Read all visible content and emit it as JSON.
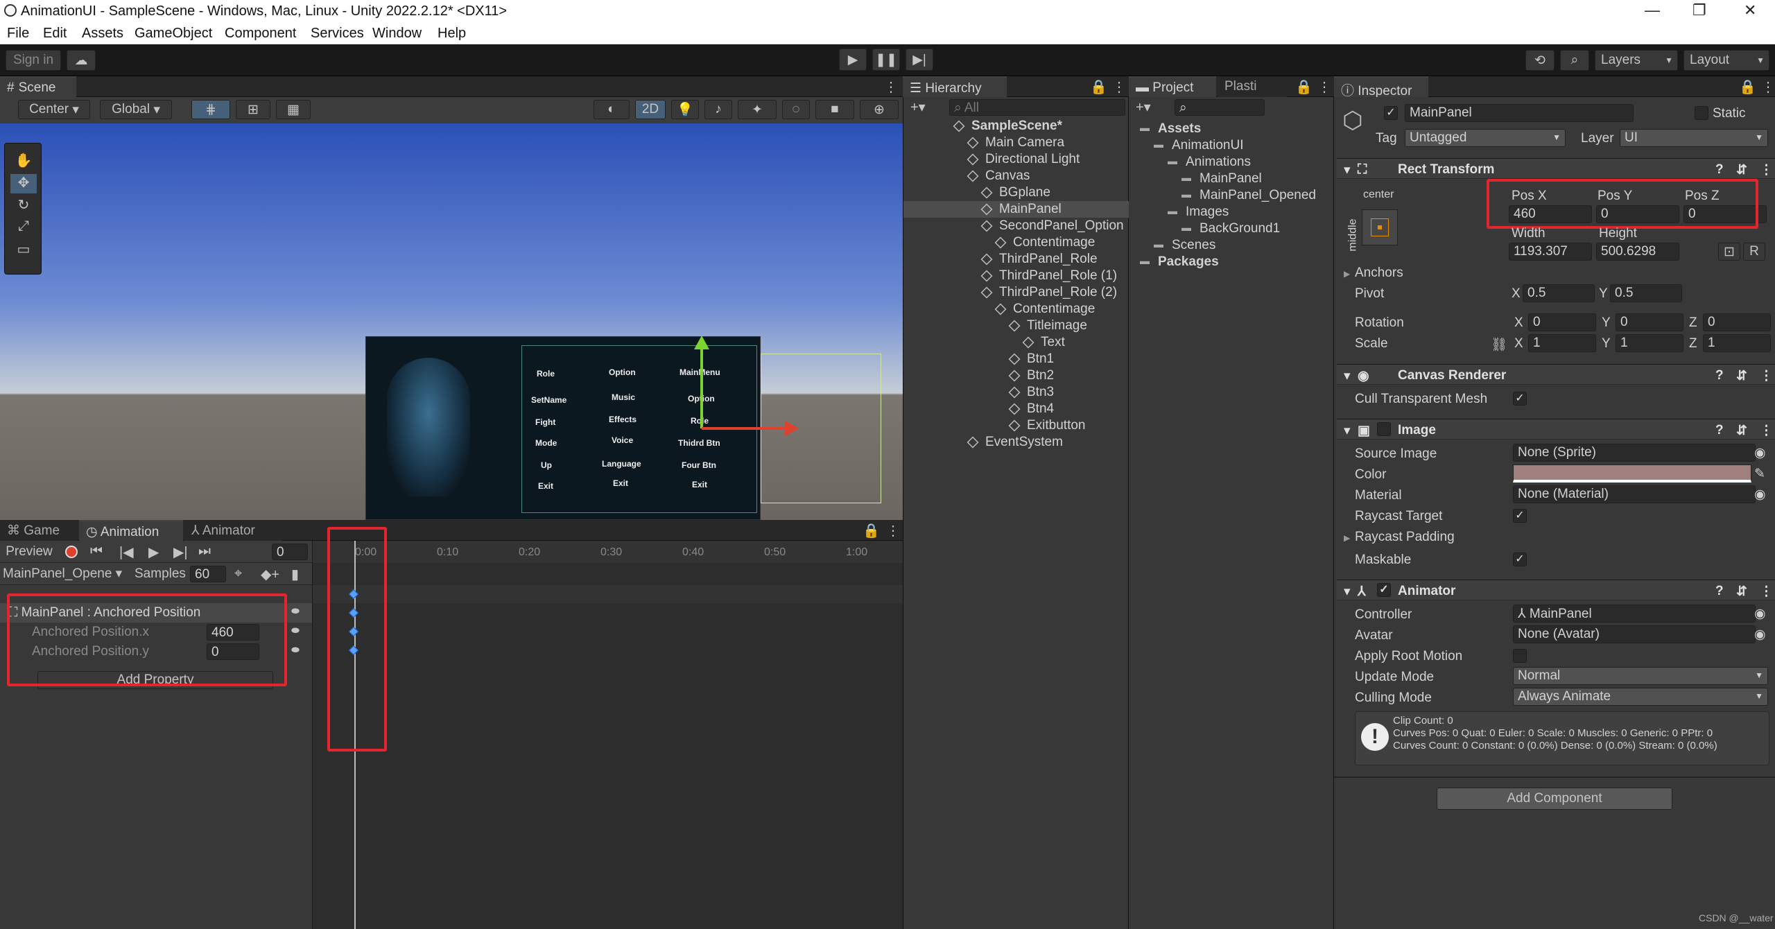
{
  "window": {
    "title": "AnimationUI - SampleScene - Windows, Mac, Linux - Unity 2022.2.12* <DX11>"
  },
  "menu": [
    "File",
    "Edit",
    "Assets",
    "GameObject",
    "Component",
    "Services",
    "Window",
    "Help"
  ],
  "toolbar": {
    "sign_in": "Sign in",
    "layers": "Layers",
    "layout": "Layout"
  },
  "scene": {
    "tab": "Scene",
    "pivot": "Center",
    "space": "Global",
    "mode2d": "2D",
    "game_labels": {
      "c1": [
        "Role",
        "SetName",
        "Fight",
        "Mode",
        "Up",
        "Exit"
      ],
      "c2": [
        "Option",
        "Music",
        "Effects",
        "Voice",
        "Language",
        "Exit"
      ],
      "c3": [
        "MainMenu",
        "Option",
        "Role",
        "Thidrd Btn",
        "Four Btn",
        "Exit"
      ]
    }
  },
  "hierarchy": {
    "tab": "Hierarchy",
    "search": "All",
    "items": [
      {
        "label": "SampleScene*",
        "indent": 0,
        "bold": true
      },
      {
        "label": "Main Camera",
        "indent": 1
      },
      {
        "label": "Directional Light",
        "indent": 1
      },
      {
        "label": "Canvas",
        "indent": 1
      },
      {
        "label": "BGplane",
        "indent": 2
      },
      {
        "label": "MainPanel",
        "indent": 2,
        "selected": true
      },
      {
        "label": "SecondPanel_Option",
        "indent": 2
      },
      {
        "label": "Contentimage",
        "indent": 3
      },
      {
        "label": "ThirdPanel_Role",
        "indent": 2
      },
      {
        "label": "ThirdPanel_Role (1)",
        "indent": 2
      },
      {
        "label": "ThirdPanel_Role (2)",
        "indent": 2
      },
      {
        "label": "Contentimage",
        "indent": 3
      },
      {
        "label": "Titleimage",
        "indent": 4
      },
      {
        "label": "Text",
        "indent": 5
      },
      {
        "label": "Btn1",
        "indent": 4
      },
      {
        "label": "Btn2",
        "indent": 4
      },
      {
        "label": "Btn3",
        "indent": 4
      },
      {
        "label": "Btn4",
        "indent": 4
      },
      {
        "label": "Exitbutton",
        "indent": 4
      },
      {
        "label": "EventSystem",
        "indent": 1
      }
    ]
  },
  "project": {
    "tab": "Project",
    "tab2": "Plasti",
    "items": [
      {
        "label": "Assets",
        "indent": 0,
        "bold": true
      },
      {
        "label": "AnimationUI",
        "indent": 1
      },
      {
        "label": "Animations",
        "indent": 2
      },
      {
        "label": "MainPanel",
        "indent": 3
      },
      {
        "label": "MainPanel_Opened",
        "indent": 3
      },
      {
        "label": "Images",
        "indent": 2
      },
      {
        "label": "BackGround1",
        "indent": 3
      },
      {
        "label": "Scenes",
        "indent": 1
      },
      {
        "label": "Packages",
        "indent": 0,
        "bold": true
      }
    ]
  },
  "inspector": {
    "tab": "Inspector",
    "name": "MainPanel",
    "static": "Static",
    "tag_label": "Tag",
    "tag": "Untagged",
    "layer_label": "Layer",
    "layer": "UI",
    "rect": {
      "title": "Rect Transform",
      "anchor": "center",
      "side": "middle",
      "posx_l": "Pos X",
      "posy_l": "Pos Y",
      "posz_l": "Pos Z",
      "posx": "460",
      "posy": "0",
      "posz": "0",
      "w_l": "Width",
      "h_l": "Height",
      "w": "1193.307",
      "h": "500.6298",
      "anchors": "Anchors",
      "pivot": "Pivot",
      "pivx": "0.5",
      "pivy": "0.5",
      "rotation": "Rotation",
      "rx": "0",
      "ry": "0",
      "rz": "0",
      "scale": "Scale",
      "sx": "1",
      "sy": "1",
      "sz": "1",
      "X": "X",
      "Y": "Y",
      "Z": "Z"
    },
    "canvas_renderer": {
      "title": "Canvas Renderer",
      "cull": "Cull Transparent Mesh"
    },
    "image": {
      "title": "Image",
      "source_l": "Source Image",
      "source": "None (Sprite)",
      "color_l": "Color",
      "material_l": "Material",
      "material": "None (Material)",
      "raycast": "Raycast Target",
      "padding": "Raycast Padding",
      "maskable": "Maskable"
    },
    "animator": {
      "title": "Animator",
      "controller_l": "Controller",
      "controller": "MainPanel",
      "avatar_l": "Avatar",
      "avatar": "None (Avatar)",
      "root": "Apply Root Motion",
      "update_l": "Update Mode",
      "update": "Normal",
      "culling_l": "Culling Mode",
      "culling": "Always Animate",
      "info1": "Clip Count: 0",
      "info2": "Curves Pos: 0 Quat: 0 Euler: 0 Scale: 0 Muscles: 0 Generic: 0 PPtr: 0",
      "info3": "Curves Count: 0 Constant: 0 (0.0%) Dense: 0 (0.0%) Stream: 0 (0.0%)"
    },
    "add_component": "Add Component"
  },
  "animation": {
    "tab_game": "Game",
    "tab_anim": "Animation",
    "tab_animator": "Animator",
    "preview": "Preview",
    "frame": "0",
    "clip": "MainPanel_Opene",
    "samples_l": "Samples",
    "samples": "60",
    "prop": "MainPanel : Anchored Position",
    "px": "Anchored Position.x",
    "py": "Anchored Position.y",
    "vx": "460",
    "vy": "0",
    "add_property": "Add Property",
    "ticks": [
      "0:00",
      "0:10",
      "0:20",
      "0:30",
      "0:40",
      "0:50",
      "1:00"
    ]
  },
  "watermark": "CSDN @__water",
  "colors": {
    "accent_red": "#e3262e",
    "selection": "#2c5d87",
    "image_color": "#a07f7f"
  }
}
